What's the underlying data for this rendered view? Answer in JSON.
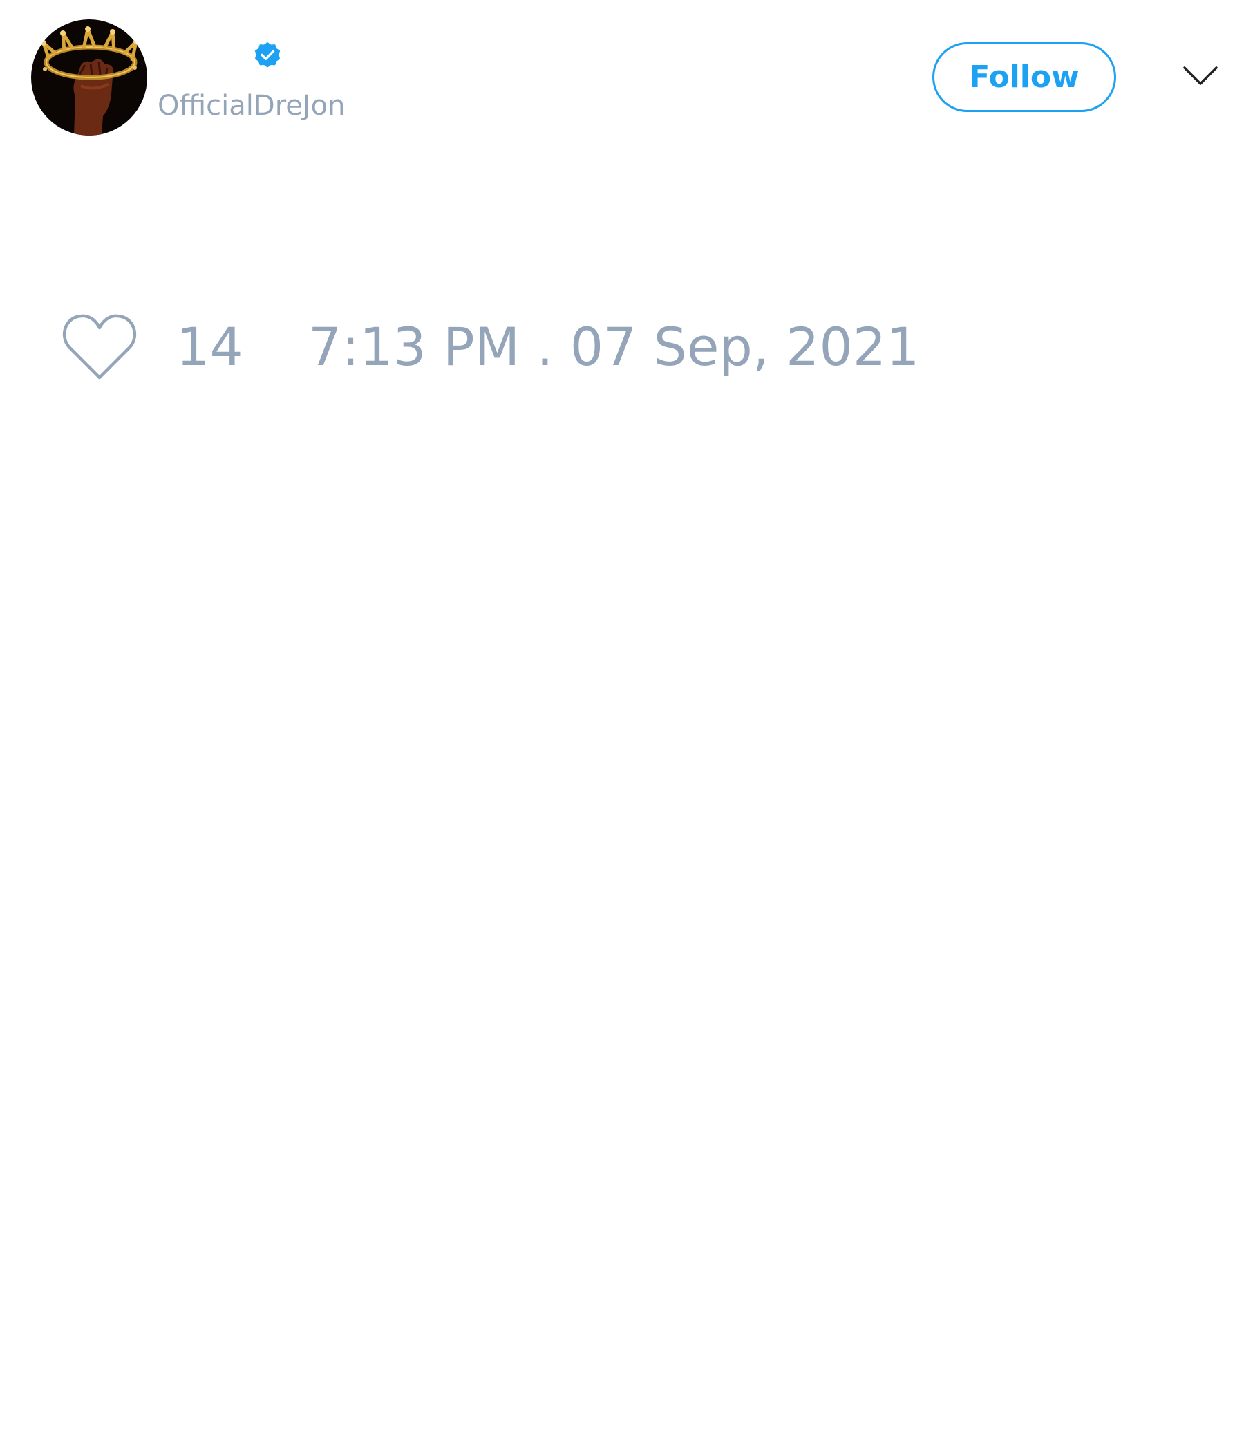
{
  "tweet": {
    "author": {
      "display_name": "",
      "username": "OfficialDreJon",
      "verified": true,
      "avatar_icon": "crown-fist-avatar"
    },
    "follow_label": "Follow",
    "menu_icon": "chevron-down-icon",
    "like_icon": "heart-icon",
    "like_count": "14",
    "timestamp": "7:13 PM . 07 Sep, 2021"
  },
  "colors": {
    "accent": "#1da1f2",
    "muted_text": "#95a5b9",
    "icon_dark": "#222222",
    "background": "#ffffff"
  }
}
